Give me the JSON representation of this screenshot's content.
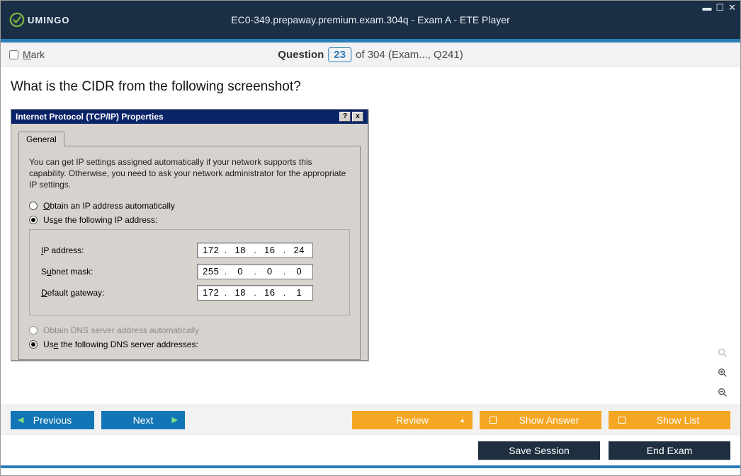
{
  "window": {
    "brand": "UMINGO",
    "title": "EC0-349.prepaway.premium.exam.304q - Exam A - ETE Player"
  },
  "infobar": {
    "mark_label_before": "M",
    "mark_label_after": "ark",
    "question_label": "Question",
    "question_number": "23",
    "question_total_text": "of 304 (Exam..., Q241)"
  },
  "question": {
    "text": "What is the CIDR from the following screenshot?"
  },
  "dialog": {
    "title": "Internet Protocol (TCP/IP) Properties",
    "tab_general": "General",
    "description": "You can get IP settings assigned automatically if your network supports this capability. Otherwise, you need to ask your network administrator for the appropriate IP settings.",
    "radio_obtain_ip": "btain an IP address automatically",
    "radio_obtain_ip_u": "O",
    "radio_use_ip": "e the following IP address:",
    "radio_use_ip_u": "Us",
    "ip_label_u": "I",
    "ip_label": "P address:",
    "subnet_label_u": "S",
    "subnet_label": "ubnet mask:",
    "gateway_label_u": "D",
    "gateway_label": "efault gateway:",
    "ip": {
      "a": "172",
      "b": "18",
      "c": "16",
      "d": "24"
    },
    "mask": {
      "a": "255",
      "b": "0",
      "c": "0",
      "d": "0"
    },
    "gw": {
      "a": "172",
      "b": "18",
      "c": "16",
      "d": "1"
    },
    "radio_obtain_dns_u": "O",
    "radio_obtain_dns": "btain DNS server address automatically",
    "radio_use_dns_u": "e",
    "radio_use_dns_pre": "Us",
    "radio_use_dns": " the following DNS server addresses:"
  },
  "nav": {
    "previous": "Previous",
    "next": "Next",
    "review": "Review",
    "show_answer": "Show Answer",
    "show_list": "Show List",
    "save_session": "Save Session",
    "end_exam": "End Exam"
  }
}
